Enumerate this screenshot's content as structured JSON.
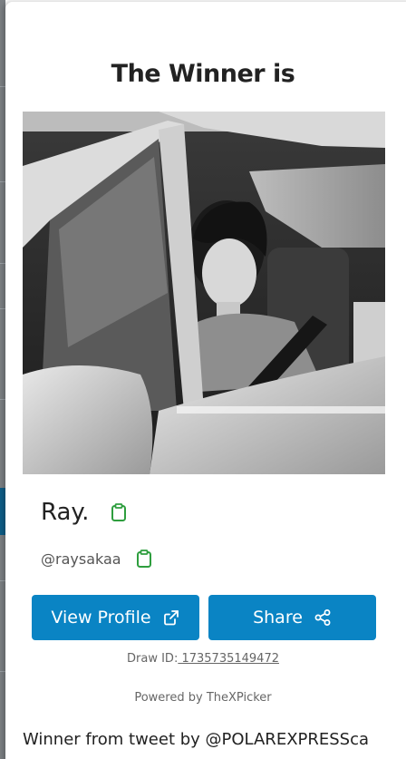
{
  "modal": {
    "title": "The Winner is"
  },
  "winner": {
    "name": "Ray.",
    "handle": "@raysakaa",
    "photo_alt": "Winner profile photo"
  },
  "actions": {
    "view_profile_label": "View Profile",
    "share_label": "Share"
  },
  "draw": {
    "id_label": "Draw ID:",
    "id_value": " 1735735149472"
  },
  "footer": {
    "powered_by": "Powered by TheXPicker",
    "tweet_source": "Winner from tweet by @POLAREXPRESSca"
  },
  "icons": {
    "copy": "clipboard-icon",
    "external": "external-link-icon",
    "share": "share-nodes-icon"
  },
  "colors": {
    "primary_button": "#0a84c4",
    "copy_icon": "#2e9e3e",
    "title_text": "#222222",
    "muted_text": "#666666"
  }
}
